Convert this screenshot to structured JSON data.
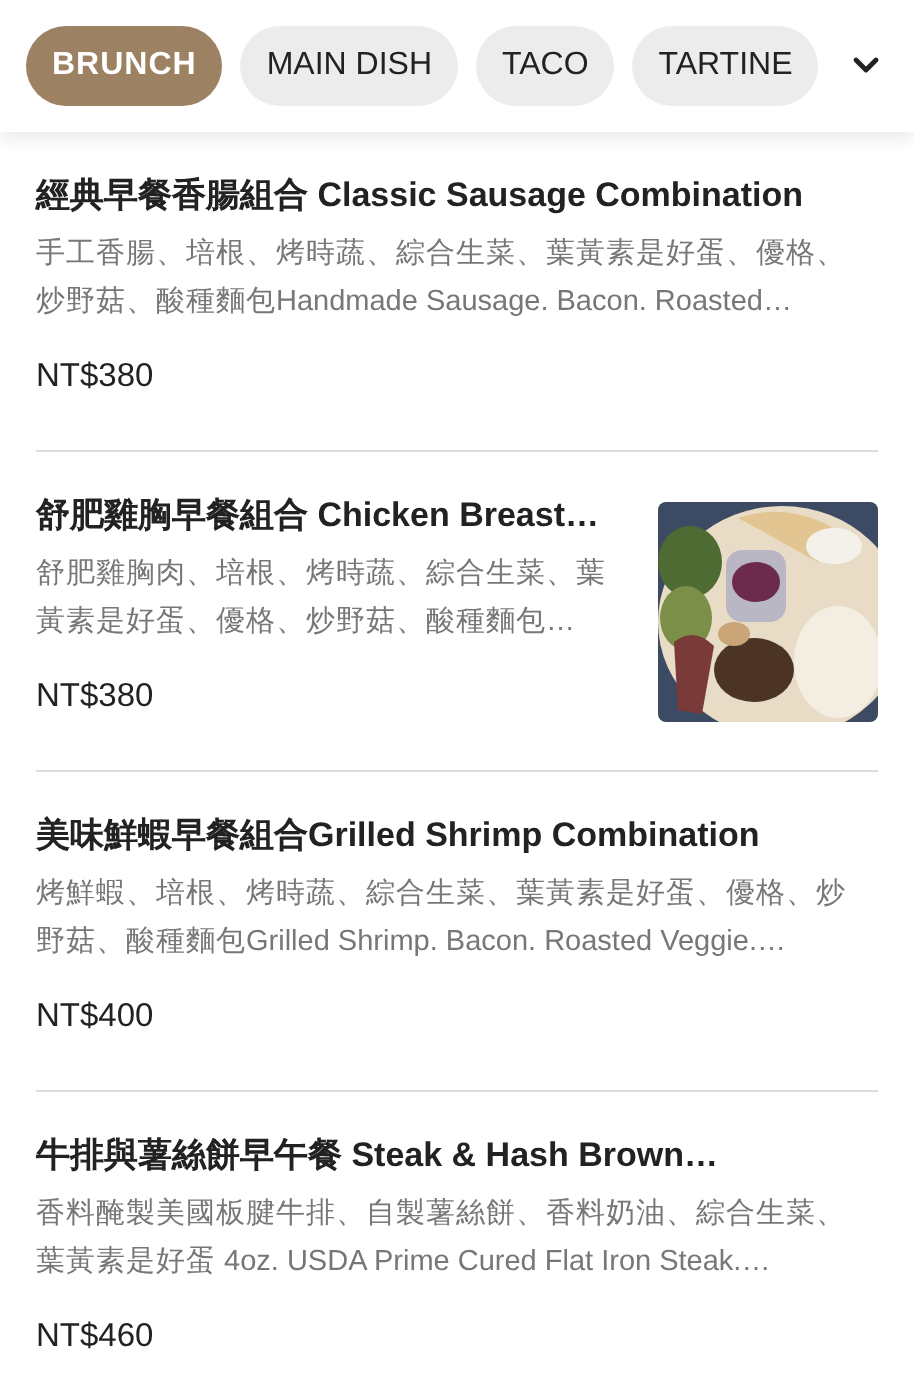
{
  "tabs": [
    {
      "label": "BRUNCH",
      "selected": true
    },
    {
      "label": "MAIN DISH",
      "selected": false
    },
    {
      "label": "TACO",
      "selected": false
    },
    {
      "label": "TARTINE",
      "selected": false
    }
  ],
  "items": [
    {
      "title": "經典早餐香腸組合 Classic Sausage Combination",
      "description_lines": [
        "手工香腸、培根、烤時蔬、綜合生菜、葉黃素是好蛋、優格、",
        "炒野菇、酸種麵包Handmade Sausage. Bacon. Roasted…"
      ],
      "price": "NT$380"
    },
    {
      "title": "舒肥雞胸早餐組合 Chicken Breast…",
      "description_lines": [
        "舒肥雞胸肉、培根、烤時蔬、綜合生菜、葉",
        "黃素是好蛋、優格、炒野菇、酸種麵包…"
      ],
      "price": "NT$380"
    },
    {
      "title": "美味鮮蝦早餐組合Grilled Shrimp Combination",
      "description_lines": [
        "烤鮮蝦、培根、烤時蔬、綜合生菜、葉黃素是好蛋、優格、炒",
        "野菇、酸種麵包Grilled Shrimp. Bacon. Roasted Veggie.…"
      ],
      "price": "NT$400"
    },
    {
      "title": "牛排與薯絲餅早午餐 Steak & Hash Brown…",
      "description_lines": [
        "香料醃製美國板腱牛排、自製薯絲餅、香料奶油、綜合生菜、",
        "葉黃素是好蛋 4oz. USDA Prime Cured Flat Iron Steak.…"
      ],
      "price": "NT$460"
    }
  ]
}
